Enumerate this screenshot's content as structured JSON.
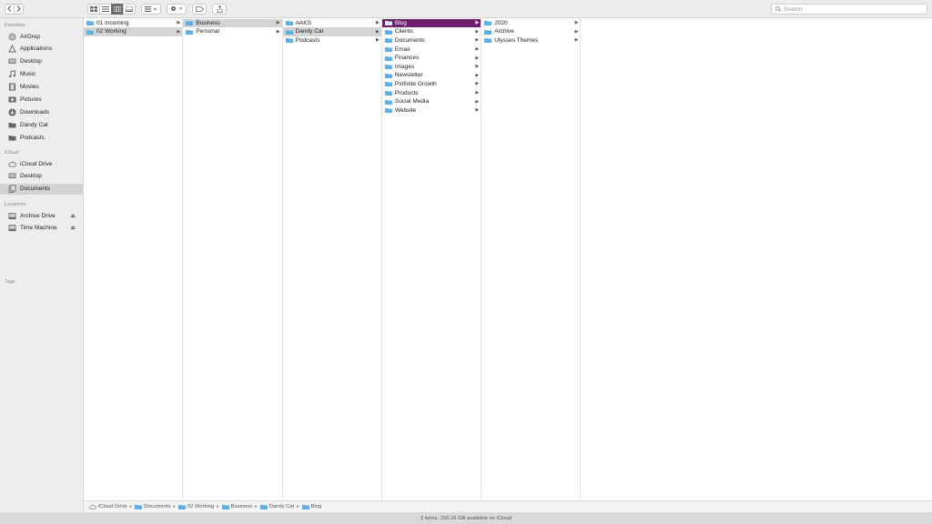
{
  "colors": {
    "accent": "#6e1f6e",
    "folder": "#5ab0e8"
  },
  "search": {
    "placeholder": "Search"
  },
  "sidebar": {
    "favorites_label": "Favorites",
    "favorites": [
      {
        "label": "AirDrop",
        "icon": "airdrop-icon"
      },
      {
        "label": "Applications",
        "icon": "applications-icon"
      },
      {
        "label": "Desktop",
        "icon": "desktop-icon"
      },
      {
        "label": "Music",
        "icon": "music-icon"
      },
      {
        "label": "Movies",
        "icon": "movies-icon"
      },
      {
        "label": "Pictures",
        "icon": "pictures-icon"
      },
      {
        "label": "Downloads",
        "icon": "downloads-icon"
      },
      {
        "label": "Dandy Cat",
        "icon": "folder-icon"
      },
      {
        "label": "Podcasts",
        "icon": "folder-icon"
      }
    ],
    "icloud_label": "iCloud",
    "icloud": [
      {
        "label": "iCloud Drive",
        "icon": "cloud-icon"
      },
      {
        "label": "Desktop",
        "icon": "desktop-icon"
      },
      {
        "label": "Documents",
        "icon": "documents-icon",
        "selected": true
      }
    ],
    "locations_label": "Locations",
    "locations": [
      {
        "label": "Archive Drive",
        "icon": "drive-icon"
      },
      {
        "label": "Time Machine",
        "icon": "drive-icon"
      }
    ],
    "tags_label": "Tags"
  },
  "columns": [
    [
      {
        "name": "01 Incoming"
      },
      {
        "name": "02 Working",
        "state": "gray"
      }
    ],
    [
      {
        "name": "Business",
        "state": "gray"
      },
      {
        "name": "Personal"
      }
    ],
    [
      {
        "name": "AAKS"
      },
      {
        "name": "Dandy Cat",
        "state": "gray"
      },
      {
        "name": "Podcasts"
      }
    ],
    [
      {
        "name": "Blog",
        "state": "purple"
      },
      {
        "name": "Clients"
      },
      {
        "name": "Documents"
      },
      {
        "name": "Email"
      },
      {
        "name": "Finances"
      },
      {
        "name": "Images"
      },
      {
        "name": "Newsletter"
      },
      {
        "name": "Pinfinite Growth"
      },
      {
        "name": "Products"
      },
      {
        "name": "Social Media"
      },
      {
        "name": "Website"
      }
    ],
    [
      {
        "name": "2020"
      },
      {
        "name": "Archive"
      },
      {
        "name": "Ulysses Themes"
      }
    ]
  ],
  "pathbar": [
    "iCloud Drive",
    "Documents",
    "02 Working",
    "Business",
    "Dandy Cat",
    "Blog"
  ],
  "status": "3 items, 155.16 GB available on iCloud"
}
